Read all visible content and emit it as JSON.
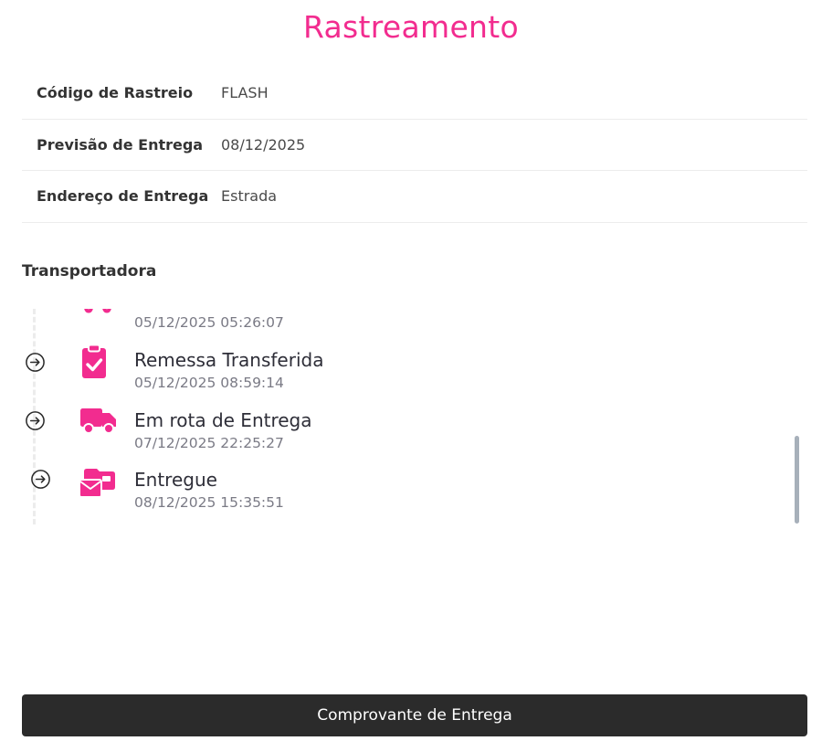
{
  "page": {
    "title": "Rastreamento"
  },
  "info": [
    {
      "label": "Código de Rastreio",
      "value": "FLASH"
    },
    {
      "label": "Previsão de Entrega",
      "value": "08/12/2025"
    },
    {
      "label": "Endereço de Entrega",
      "value": "Estrada"
    }
  ],
  "carrier": {
    "heading": "Transportadora"
  },
  "events": [
    {
      "title": "",
      "date": "05/12/2025 05:26:07",
      "icon": "package-icon"
    },
    {
      "title": "Remessa Transferida",
      "date": "05/12/2025 08:59:14",
      "icon": "clipboard-check-icon"
    },
    {
      "title": "Em rota de Entrega",
      "date": "07/12/2025 22:25:27",
      "icon": "truck-icon"
    },
    {
      "title": "Entregue",
      "date": "08/12/2025 15:35:51",
      "icon": "mail-delivered-icon"
    }
  ],
  "colors": {
    "accent": "#f22c8f",
    "button": "#2b2b2b"
  },
  "actions": {
    "receipt_label": "Comprovante de Entrega"
  }
}
